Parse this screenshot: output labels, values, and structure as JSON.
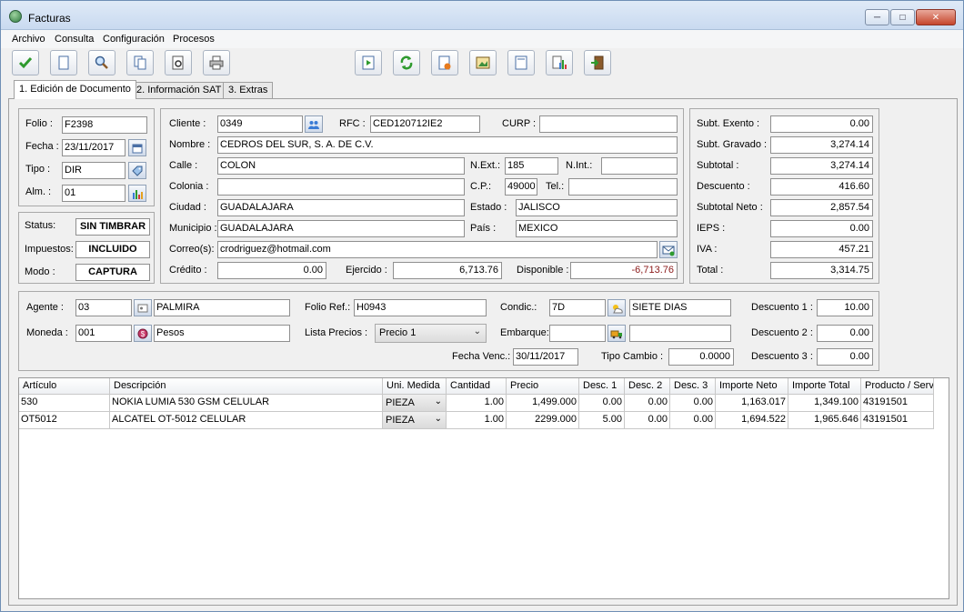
{
  "window": {
    "title": "Facturas",
    "min": "─",
    "max": "□",
    "close": "✕"
  },
  "menu": [
    "Archivo",
    "Consulta",
    "Configuración",
    "Procesos"
  ],
  "tabs": [
    "1. Edición de Documento",
    "2. Información SAT",
    "3. Extras"
  ],
  "doc": {
    "folio_label": "Folio :",
    "folio": "F2398",
    "fecha_label": "Fecha :",
    "fecha": "23/11/2017",
    "tipo_label": "Tipo :",
    "tipo": "DIR",
    "alm_label": "Alm. :",
    "alm": "01"
  },
  "status": {
    "status_label": "Status:",
    "status": "SIN TIMBRAR",
    "impuestos_label": "Impuestos:",
    "impuestos": "INCLUIDO",
    "modo_label": "Modo :",
    "modo": "CAPTURA"
  },
  "cliente": {
    "cliente_label": "Cliente :",
    "cliente": "0349",
    "rfc_label": "RFC :",
    "rfc": "CED120712IE2",
    "curp_label": "CURP :",
    "curp": "",
    "nombre_label": "Nombre :",
    "nombre": "CEDROS DEL SUR, S. A. DE C.V.",
    "calle_label": "Calle :",
    "calle": "COLON",
    "next_label": "N.Ext.:",
    "next": "185",
    "nint_label": "N.Int.:",
    "nint": "",
    "colonia_label": "Colonia :",
    "colonia": "",
    "cp_label": "C.P.:",
    "cp": "49000",
    "tel_label": "Tel.:",
    "tel": "",
    "ciudad_label": "Ciudad :",
    "ciudad": "GUADALAJARA",
    "estado_label": "Estado :",
    "estado": "JALISCO",
    "municipio_label": "Municipio :",
    "municipio": "GUADALAJARA",
    "pais_label": "País :",
    "pais": "MEXICO",
    "correo_label": "Correo(s):",
    "correo": "crodriguez@hotmail.com",
    "credito_label": "Crédito :",
    "credito": "0.00",
    "ejercido_label": "Ejercido :",
    "ejercido": "6,713.76",
    "disponible_label": "Disponible :",
    "disponible": "-6,713.76"
  },
  "totales": {
    "subt_exento_label": "Subt. Exento :",
    "subt_exento": "0.00",
    "subt_gravado_label": "Subt. Gravado :",
    "subt_gravado": "3,274.14",
    "subtotal_label": "Subtotal :",
    "subtotal": "3,274.14",
    "descuento_label": "Descuento :",
    "descuento": "416.60",
    "subtotal_neto_label": "Subtotal Neto :",
    "subtotal_neto": "2,857.54",
    "ieps_label": "IEPS :",
    "ieps": "0.00",
    "iva_label": "IVA :",
    "iva": "457.21",
    "total_label": "Total :",
    "total": "3,314.75"
  },
  "extra": {
    "agente_label": "Agente :",
    "agente": "03",
    "agente_nombre": "PALMIRA",
    "moneda_label": "Moneda :",
    "moneda": "001",
    "moneda_nombre": "Pesos",
    "folio_ref_label": "Folio Ref.:",
    "folio_ref": "H0943",
    "lista_precios_label": "Lista Precios :",
    "lista_precios": "Precio 1",
    "condic_label": "Condic.:",
    "condic": "7D",
    "condic_nombre": "SIETE DIAS",
    "embarque_label": "Embarque:",
    "embarque": "",
    "embarque_nombre": "",
    "fecha_venc_label": "Fecha Venc.:",
    "fecha_venc": "30/11/2017",
    "tipo_cambio_label": "Tipo Cambio :",
    "tipo_cambio": "0.0000",
    "descuento1_label": "Descuento 1 :",
    "descuento1": "10.00",
    "descuento2_label": "Descuento 2 :",
    "descuento2": "0.00",
    "descuento3_label": "Descuento 3 :",
    "descuento3": "0.00"
  },
  "grid": {
    "columns": [
      "Artículo",
      "Descripción",
      "Uni. Medida",
      "Cantidad",
      "Precio",
      "Desc. 1",
      "Desc. 2",
      "Desc. 3",
      "Importe Neto",
      "Importe Total",
      "Producto / Serv"
    ],
    "rows": [
      [
        "530",
        "NOKIA LUMIA 530 GSM CELULAR",
        "PIEZA",
        "1.00",
        "1,499.000",
        "0.00",
        "0.00",
        "0.00",
        "1,163.017",
        "1,349.100",
        "43191501"
      ],
      [
        "OT5012",
        "ALCATEL OT-5012 CELULAR",
        "PIEZA",
        "1.00",
        "2299.000",
        "5.00",
        "0.00",
        "0.00",
        "1,694.522",
        "1,965.646",
        "43191501"
      ]
    ]
  }
}
